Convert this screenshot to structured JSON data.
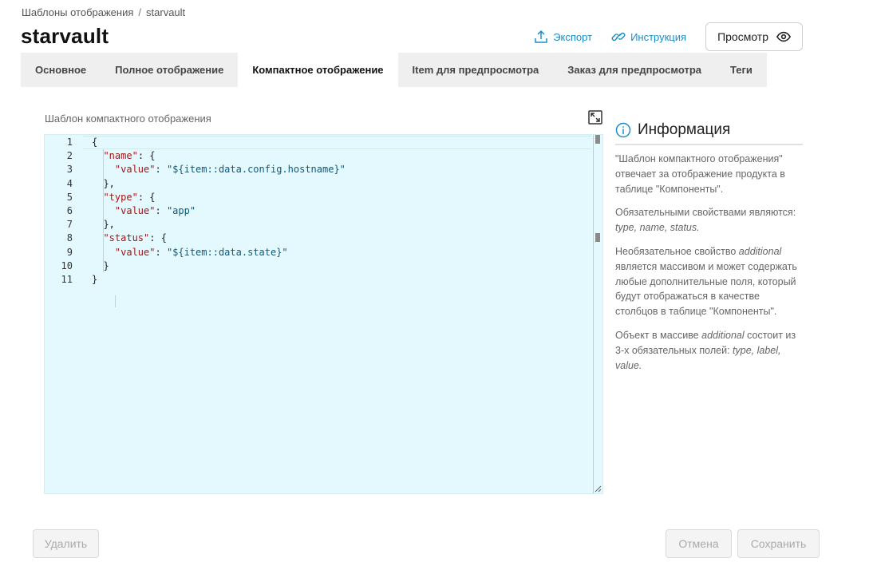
{
  "breadcrumb": {
    "parent": "Шаблоны отображения",
    "separator": "/",
    "current": "starvault"
  },
  "page": {
    "title": "starvault"
  },
  "header_actions": {
    "export_label": "Экспорт",
    "instructions_label": "Инструкция",
    "preview_label": "Просмотр"
  },
  "tabs": [
    {
      "label": "Основное",
      "active": false
    },
    {
      "label": "Полное отображение",
      "active": false
    },
    {
      "label": "Компактное отображение",
      "active": true
    },
    {
      "label": "Item для предпросмотра",
      "active": false
    },
    {
      "label": "Заказ для предпросмотра",
      "active": false
    },
    {
      "label": "Теги",
      "active": false
    }
  ],
  "editor": {
    "label": "Шаблон компактного отображения",
    "line_numbers": [
      "1",
      "2",
      "3",
      "4",
      "5",
      "6",
      "7",
      "8",
      "9",
      "10",
      "11"
    ],
    "lines": [
      [
        {
          "t": "{",
          "c": "p"
        }
      ],
      [
        {
          "t": "  ",
          "c": "p"
        },
        {
          "t": "\"name\"",
          "c": "key"
        },
        {
          "t": ": {",
          "c": "p"
        }
      ],
      [
        {
          "t": "    ",
          "c": "p"
        },
        {
          "t": "\"value\"",
          "c": "key"
        },
        {
          "t": ": ",
          "c": "p"
        },
        {
          "t": "\"${item::data.config.hostname}\"",
          "c": "str"
        }
      ],
      [
        {
          "t": "  },",
          "c": "p"
        }
      ],
      [
        {
          "t": "  ",
          "c": "p"
        },
        {
          "t": "\"type\"",
          "c": "key"
        },
        {
          "t": ": {",
          "c": "p"
        }
      ],
      [
        {
          "t": "    ",
          "c": "p"
        },
        {
          "t": "\"value\"",
          "c": "key"
        },
        {
          "t": ": ",
          "c": "p"
        },
        {
          "t": "\"app\"",
          "c": "str"
        }
      ],
      [
        {
          "t": "  },",
          "c": "p"
        }
      ],
      [
        {
          "t": "  ",
          "c": "p"
        },
        {
          "t": "\"status\"",
          "c": "key"
        },
        {
          "t": ": {",
          "c": "p"
        }
      ],
      [
        {
          "t": "    ",
          "c": "p"
        },
        {
          "t": "\"value\"",
          "c": "key"
        },
        {
          "t": ": ",
          "c": "p"
        },
        {
          "t": "\"${item::data.state}\"",
          "c": "str"
        }
      ],
      [
        {
          "t": "  }",
          "c": "p"
        }
      ],
      [
        {
          "t": "}",
          "c": "p"
        }
      ]
    ],
    "background_color": "#e3f9fd"
  },
  "info": {
    "title": "Информация",
    "p1": "\"Шаблон компактного отображения\" отвечает за отображение продукта в таблице \"Компоненты\".",
    "p2_text": "Обязательными свойствами являются:",
    "p2_props": "type, name, status.",
    "p3_a": "Необязательное свойство",
    "p3_em": "additional",
    "p3_b": "является массивом и может содержать любые дополнительные поля, который будут отображаться в качестве столбцов в таблице \"Компоненты\".",
    "p4_a": "Объект в массиве",
    "p4_em": "additional",
    "p4_b": "состоит из 3-х обязательных полей:",
    "p4_props": "type, label, value."
  },
  "footer": {
    "delete_label": "Удалить",
    "cancel_label": "Отмена",
    "save_label": "Сохранить"
  },
  "colors": {
    "accent": "#1a8fc7",
    "tab_bar": "#efefef",
    "key": "#a31515",
    "string": "#0b5a7a"
  }
}
